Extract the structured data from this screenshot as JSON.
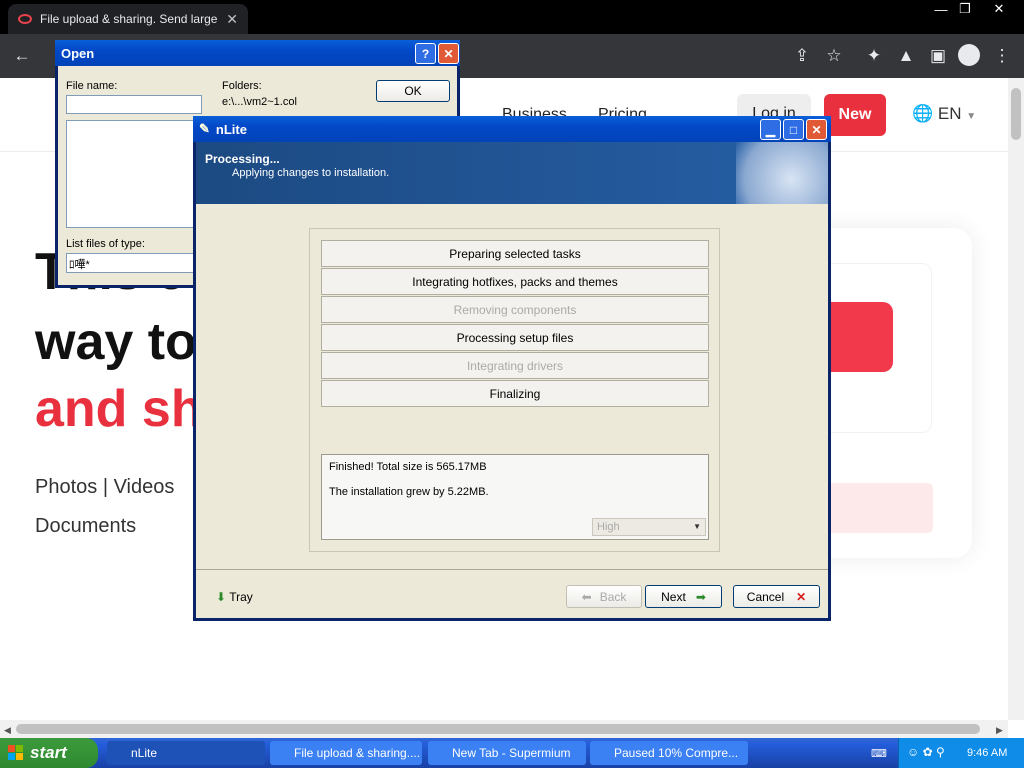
{
  "browser": {
    "tab_title": "File upload & sharing. Send large ph",
    "tab_close": "✕",
    "window_controls": [
      "—",
      "❐",
      "✕"
    ],
    "toolbar_icons": [
      "←",
      "⇪",
      "☆",
      "✦",
      "▲",
      "▣",
      "⋮"
    ]
  },
  "page": {
    "nav": [
      "Business",
      "Pricing"
    ],
    "login": "Log in",
    "new": "New",
    "lang": "EN",
    "hero": [
      "This e",
      "way to",
      "and sh"
    ],
    "sub_line1": "Photos  |  Videos",
    "sub_line2": "Documents"
  },
  "open_dialog": {
    "title": "Open",
    "help": "?",
    "close": "✕",
    "file_name_label": "File name:",
    "file_name_value": "",
    "folders_label": "Folders:",
    "folders_value": "e:\\...\\vm2~1.col",
    "ok": "OK",
    "list_files_label": "List files of type:",
    "list_files_value": "ﾛ嘩*"
  },
  "nlite": {
    "title": "nLite",
    "header_title": "Processing...",
    "header_sub": "Applying changes to installation.",
    "tasks": [
      {
        "label": "Preparing selected tasks",
        "state": "done"
      },
      {
        "label": "Integrating hotfixes, packs and themes",
        "state": "done"
      },
      {
        "label": "Removing components",
        "state": "dim"
      },
      {
        "label": "Processing setup files",
        "state": "done"
      },
      {
        "label": "Integrating drivers",
        "state": "dim"
      },
      {
        "label": "Finalizing",
        "state": "done"
      }
    ],
    "log_line1": "Finished! Total size is 565.17MB",
    "log_line2": "The installation grew by 5.22MB.",
    "priority": "High",
    "tray": "Tray",
    "back": "Back",
    "next": "Next",
    "cancel": "Cancel"
  },
  "taskbar": {
    "start": "start",
    "tasks": [
      {
        "label": "nLite",
        "active": true
      },
      {
        "label": "File upload & sharing....",
        "active": false
      },
      {
        "label": "New Tab - Supermium",
        "active": false
      },
      {
        "label": "Paused 10% Compre...",
        "active": false
      }
    ],
    "clock": "9:46 AM"
  },
  "colors": {
    "accent_red": "#e8303f",
    "xp_blue": "#0348c7",
    "nlite_header": "#1c4a82"
  }
}
